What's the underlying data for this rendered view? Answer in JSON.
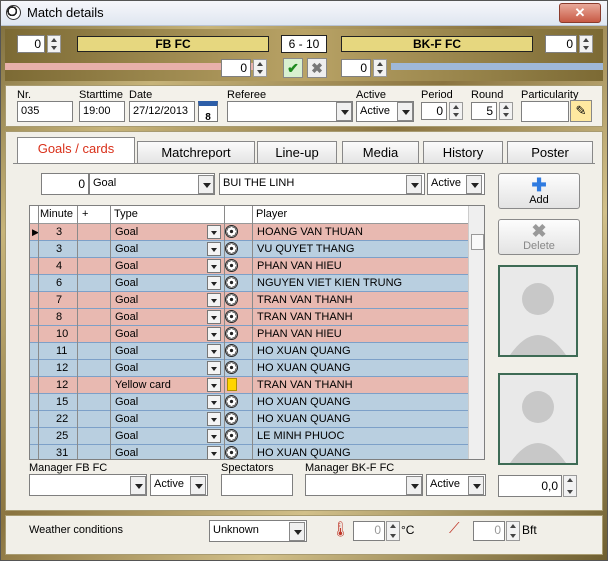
{
  "window": {
    "title": "Match details",
    "close_label": "✕"
  },
  "score": {
    "home_left_value": "0",
    "home_team": "FB FC",
    "score_text": "6  - 10",
    "away_team": "BK-F FC",
    "away_right_value": "0",
    "home_sub_value": "0",
    "away_sub_value": "0"
  },
  "info": {
    "nr_label": "Nr.",
    "nr_value": "035",
    "starttime_label": "Starttime",
    "starttime_value": "19:00",
    "date_label": "Date",
    "date_value": "27/12/2013",
    "calendar_day": "8",
    "referee_label": "Referee",
    "referee_value": "",
    "active_label": "Active",
    "active_value": "Active",
    "period_label": "Period",
    "period_value": "0",
    "round_label": "Round",
    "round_value": "5",
    "particularity_label": "Particularity",
    "particularity_value": ""
  },
  "tabs": [
    "Goals / cards",
    "Matchreport",
    "Line-up",
    "Media",
    "History",
    "Poster"
  ],
  "entry": {
    "minute": "0",
    "type": "Goal",
    "player": "BUI THE LINH",
    "status": "Active"
  },
  "grid": {
    "headers": [
      "Minute",
      "+",
      "Type",
      "Player"
    ],
    "rows": [
      {
        "minute": "3",
        "type": "Goal",
        "player": "HOANG VAN THUAN",
        "color": "pink",
        "icon": "ball"
      },
      {
        "minute": "3",
        "type": "Goal",
        "player": "VU QUYET THANG",
        "color": "blue",
        "icon": "ball"
      },
      {
        "minute": "4",
        "type": "Goal",
        "player": "PHAN VAN HIEU",
        "color": "pink",
        "icon": "ball"
      },
      {
        "minute": "6",
        "type": "Goal",
        "player": "NGUYEN VIET KIEN TRUNG",
        "color": "blue",
        "icon": "ball"
      },
      {
        "minute": "7",
        "type": "Goal",
        "player": "TRAN VAN THANH",
        "color": "pink",
        "icon": "ball"
      },
      {
        "minute": "8",
        "type": "Goal",
        "player": "TRAN VAN THANH",
        "color": "pink",
        "icon": "ball"
      },
      {
        "minute": "10",
        "type": "Goal",
        "player": "PHAN VAN HIEU",
        "color": "pink",
        "icon": "ball"
      },
      {
        "minute": "11",
        "type": "Goal",
        "player": "HO XUAN QUANG",
        "color": "blue",
        "icon": "ball"
      },
      {
        "minute": "12",
        "type": "Goal",
        "player": "HO XUAN QUANG",
        "color": "blue",
        "icon": "ball"
      },
      {
        "minute": "12",
        "type": "Yellow card",
        "player": "TRAN VAN THANH",
        "color": "pink",
        "icon": "card"
      },
      {
        "minute": "15",
        "type": "Goal",
        "player": "HO XUAN QUANG",
        "color": "blue",
        "icon": "ball"
      },
      {
        "minute": "22",
        "type": "Goal",
        "player": "HO XUAN QUANG",
        "color": "blue",
        "icon": "ball"
      },
      {
        "minute": "25",
        "type": "Goal",
        "player": "LE MINH PHUOC",
        "color": "blue",
        "icon": "ball"
      },
      {
        "minute": "31",
        "type": "Goal",
        "player": "HO XUAN QUANG",
        "color": "blue",
        "icon": "ball"
      }
    ]
  },
  "buttons": {
    "add": "Add",
    "delete": "Delete"
  },
  "footer": {
    "manager_home_label": "Manager FB FC",
    "manager_home_status": "Active",
    "spectators_label": "Spectators",
    "spectators_value": "",
    "manager_away_label": "Manager BK-F FC",
    "manager_away_status": "Active",
    "rating_value": "0,0"
  },
  "weather": {
    "label": "Weather conditions",
    "value": "Unknown",
    "temp_value": "0",
    "temp_unit": "°C",
    "wind_value": "0",
    "wind_unit": "Bft"
  },
  "colors": {
    "pink_row": "#e8b9b1",
    "blue_row": "#b9cfe0",
    "active_tab": "#d9301a",
    "team_bar": "#e6d77f"
  }
}
